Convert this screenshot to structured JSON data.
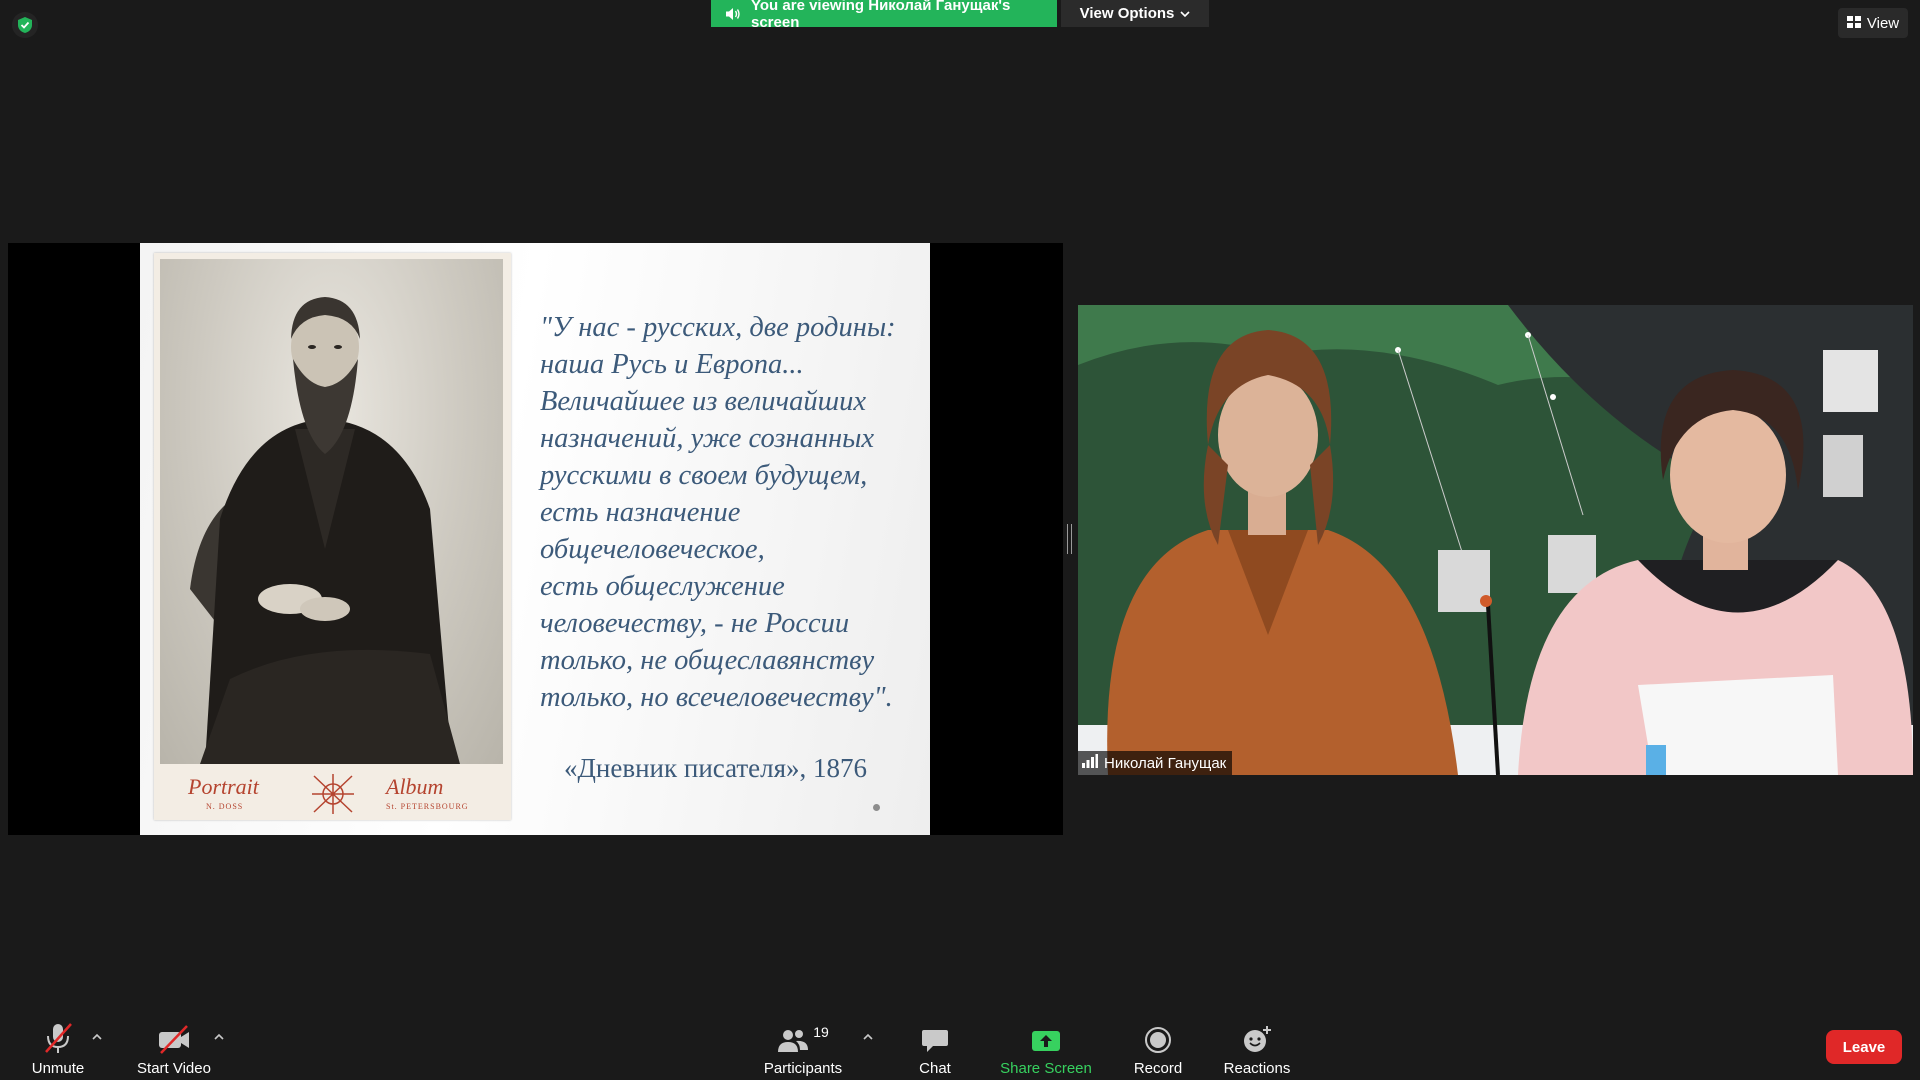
{
  "banner": {
    "viewing_text": "You are viewing Николай Ганущак's screen",
    "view_options_label": "View Options",
    "view_label": "View"
  },
  "slide": {
    "quote_lines": [
      "\"У нас - русских, две родины:",
      "наша Русь и Европа...",
      "Величайшее из величайших",
      "назначений, уже сознанных",
      "русскими в своем будущем,",
      "есть назначение",
      "общечеловеческое,",
      "есть общеслужение",
      "человечеству, - не России",
      "только, не общеславянству",
      "только, но всечеловечеству\"."
    ],
    "source": "«Дневник писателя», 1876",
    "album_left": "Portrait",
    "album_right": "Album",
    "album_left_small": "N. DOSS",
    "album_right_small": "St. PETERSBOURG"
  },
  "participant": {
    "name": "Николай Ганущак"
  },
  "toolbar": {
    "unmute_label": "Unmute",
    "start_video_label": "Start Video",
    "participants_label": "Participants",
    "participants_count": "19",
    "chat_label": "Chat",
    "share_screen_label": "Share Screen",
    "record_label": "Record",
    "reactions_label": "Reactions",
    "leave_label": "Leave"
  },
  "colors": {
    "background": "#1a1a1a",
    "banner_green": "#23b45a",
    "share_green": "#37d15f",
    "leave_red": "#e02828",
    "quote_blue": "#3c5a7a"
  }
}
